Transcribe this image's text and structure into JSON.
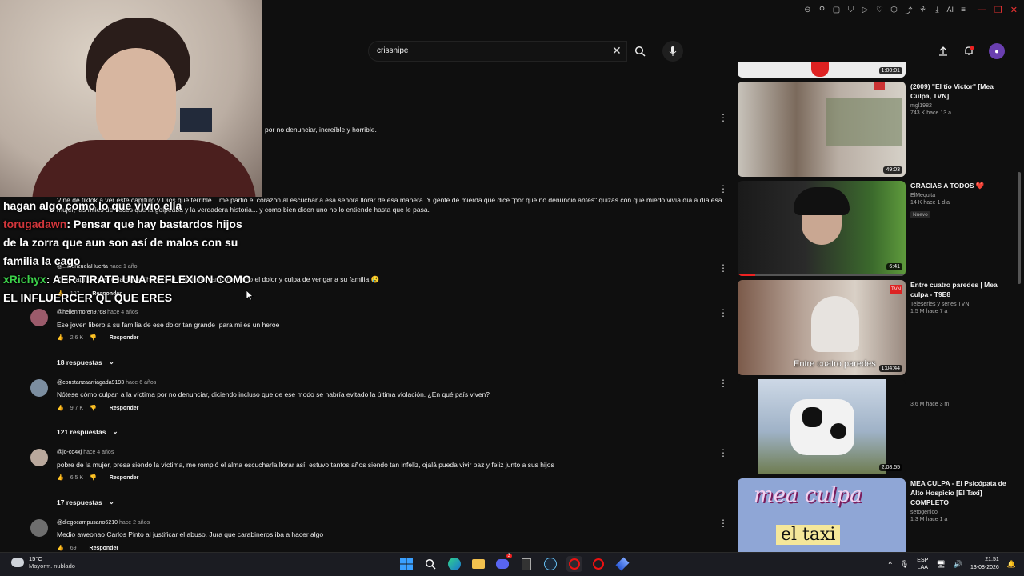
{
  "search": {
    "value": "crissnipe"
  },
  "browser": {
    "ai_label": "AI"
  },
  "chat": [
    {
      "user": "",
      "message": "hagan algo como lo que vivio ella"
    },
    {
      "user": "torugadawn",
      "message": ": Pensar que hay bastardos hijos"
    },
    {
      "user": "",
      "message": "de la zorra que aun son así de malos con su"
    },
    {
      "user": "",
      "message": "familia la cago"
    },
    {
      "user": "xRichyx",
      "message": ": AER TIRATE UNA REFLEXION COMO"
    },
    {
      "user": "",
      "message": "EL INFLUERCER QL QUE ERES"
    }
  ],
  "comments": {
    "partial1_text": "por no denunciar, increíble y horrible.",
    "partial2_text": "Vine de tiktok a ver este capítulo y Dios que terrible... me partió el corazón al escuchar a esa señora llorar de esa manera. Y gente de mierda que dice \"por qué no denunció antes\" quizás con que miedo vivía día a día esa mujer, las miles de veces que la golpeaba y la verdadera historia... y como bien dicen uno no lo entiende hasta que le pasa.",
    "partial3_author": "@...alenzuelaHuerta",
    "partial3_meta": "hace 1 año",
    "partial3_text": "Este capítulo debió llamarse \"héroe\", el hijo literal cargó con todo el dolor y culpa de vengar a su familia 😢",
    "partial3_likes": "107",
    "reply_label": "Responder",
    "c1_author": "@hellenmoren9768",
    "c1_meta": "hace 4 años",
    "c1_text": "Ese joven libero a su familia de ese dolor tan grande ,para mi es un heroe",
    "c1_likes": "2.6 K",
    "c1_replies": "18 respuestas",
    "c2_author": "@constanzaarriagada9193",
    "c2_meta": "hace 6 años",
    "c2_text": "Nótese cómo culpan a la víctima por no denunciar, diciendo incluso que de ese modo se habría evitado la última violación. ¿En qué país viven?",
    "c2_likes": "9.7 K",
    "c2_replies": "121 respuestas",
    "c3_author": "@jo-co4xj",
    "c3_meta": "hace 4 años",
    "c3_text": "pobre de la mujer, presa siendo la víctima, me rompió el alma escucharla llorar así, estuvo tantos años siendo tan infeliz, ojalá pueda vivir paz y feliz junto a sus hijos",
    "c3_likes": "6.5 K",
    "c3_replies": "17 respuestas",
    "c4_author": "@diegocampusano6210",
    "c4_meta": "hace 2 años",
    "c4_text": "Medio aweonao Carlos Pinto al justificar el abuso. Jura que carabineros iba a hacer algo",
    "c4_likes": "69"
  },
  "sidebar": [
    {
      "title": "",
      "channel": "",
      "stats": "",
      "duration": "1:00:01"
    },
    {
      "title": "(2009) \"El tío Victor\" [Mea Culpa, TVN]",
      "channel": "mgl1982",
      "stats": "743 K hace 13 a",
      "duration": "49:03"
    },
    {
      "title": "GRACIAS A TODOS ❤️",
      "channel": "ElMequita",
      "stats": "14 K hace 1 día",
      "badge": "Nuevo",
      "duration": "6:41"
    },
    {
      "title": "Entre cuatro paredes | Mea culpa - T9E8",
      "channel": "Teleseries y series TVN",
      "stats": "1.5 M hace 7 a",
      "duration": "1:04:44",
      "overlay": "Entre cuatro paredes"
    },
    {
      "title": "",
      "channel": "",
      "stats": "3.6 M hace 3 m",
      "duration": "2:08:55"
    },
    {
      "title": "MEA CULPA - El Psicópata de Alto Hospicio [El Taxi] COMPLETO",
      "channel": "setogenico",
      "stats": "1.3 M hace 1 a",
      "overlay1": "mea culpa",
      "overlay2": "el taxi"
    }
  ],
  "taskbar": {
    "temp": "15°C",
    "weather": "Mayorm. nublado",
    "lang1": "ESP",
    "lang2": "LAA",
    "time": "21:51",
    "date": "13-08-2026",
    "discord_badge": "3"
  },
  "colors": {
    "red": "#d0363b",
    "green": "#3cd14a",
    "bg": "#0f0f0f"
  }
}
